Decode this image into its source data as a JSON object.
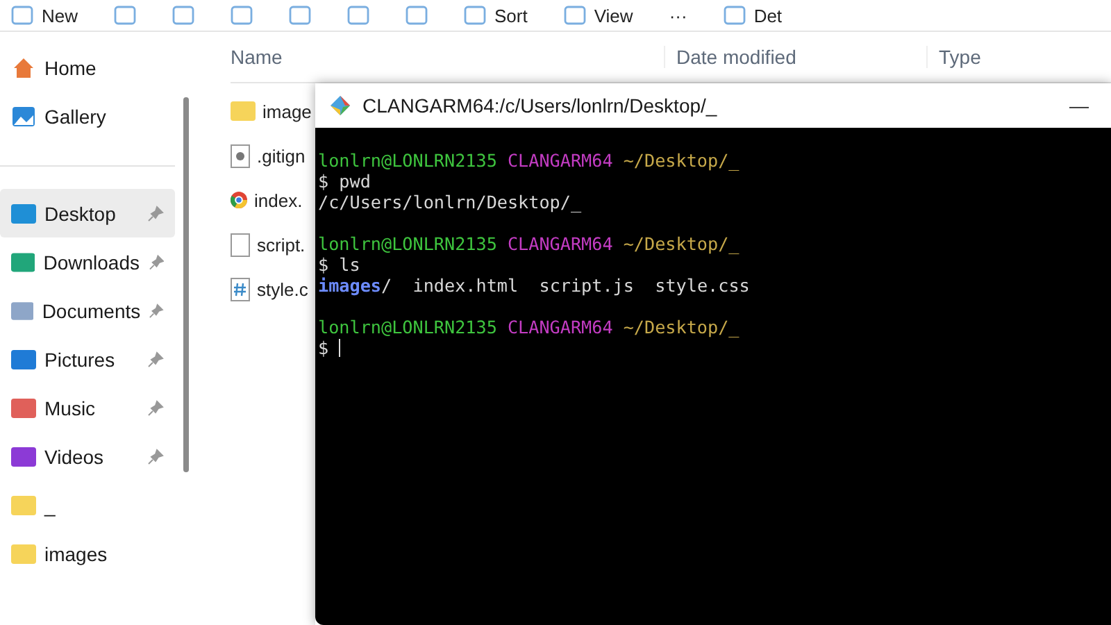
{
  "toolbar": [
    {
      "label": "New"
    },
    {
      "label": "Sort"
    },
    {
      "label": "View"
    },
    {
      "label": "···"
    },
    {
      "label": "Det"
    }
  ],
  "sidebar": {
    "items": [
      {
        "label": "Home",
        "kind": "home",
        "pinned": false,
        "selected": false
      },
      {
        "label": "Gallery",
        "kind": "gallery",
        "pinned": false,
        "selected": false
      },
      {
        "label": "Desktop",
        "kind": "desktop",
        "pinned": true,
        "selected": true
      },
      {
        "label": "Downloads",
        "kind": "downloads",
        "pinned": true,
        "selected": false
      },
      {
        "label": "Documents",
        "kind": "documents",
        "pinned": true,
        "selected": false
      },
      {
        "label": "Pictures",
        "kind": "pictures",
        "pinned": true,
        "selected": false
      },
      {
        "label": "Music",
        "kind": "music",
        "pinned": true,
        "selected": false
      },
      {
        "label": "Videos",
        "kind": "videos",
        "pinned": true,
        "selected": false
      },
      {
        "label": "_",
        "kind": "folder",
        "pinned": false,
        "selected": false
      },
      {
        "label": "images",
        "kind": "folder",
        "pinned": false,
        "selected": false
      }
    ]
  },
  "files": {
    "columns": [
      "Name",
      "Date modified",
      "Type"
    ],
    "rows": [
      {
        "name": "image",
        "kind": "folder"
      },
      {
        "name": ".gitign",
        "kind": "gear"
      },
      {
        "name": "index.",
        "kind": "chrome"
      },
      {
        "name": "script.",
        "kind": "blank"
      },
      {
        "name": "style.c",
        "kind": "css"
      }
    ]
  },
  "terminal": {
    "title": "CLANGARM64:/c/Users/lonlrn/Desktop/_",
    "minimize": "—",
    "cursor": true,
    "blocks": [
      [
        [
          {
            "kind": "user",
            "text": "lonlrn@LONLRN2135"
          },
          {
            "kind": "env",
            "text": "CLANGARM64"
          },
          {
            "kind": "path",
            "text": "~/Desktop/_"
          }
        ],
        [
          {
            "kind": "plain",
            "text": "$ pwd"
          }
        ],
        [
          {
            "kind": "plain",
            "text": "/c/Users/lonlrn/Desktop/_"
          }
        ]
      ],
      [
        [
          {
            "kind": "user",
            "text": "lonlrn@LONLRN2135"
          },
          {
            "kind": "env",
            "text": "CLANGARM64"
          },
          {
            "kind": "path",
            "text": "~/Desktop/_"
          }
        ],
        [
          {
            "kind": "plain",
            "text": "$ ls"
          }
        ],
        [
          {
            "kind": "dir",
            "text": "images"
          },
          {
            "kind": "plain",
            "text": "/  index.html  script.js  style.css"
          }
        ]
      ],
      [
        [
          {
            "kind": "user",
            "text": "lonlrn@LONLRN2135"
          },
          {
            "kind": "env",
            "text": "CLANGARM64"
          },
          {
            "kind": "path",
            "text": "~/Desktop/_"
          }
        ],
        [
          {
            "kind": "plain",
            "text": "$"
          }
        ]
      ]
    ]
  }
}
